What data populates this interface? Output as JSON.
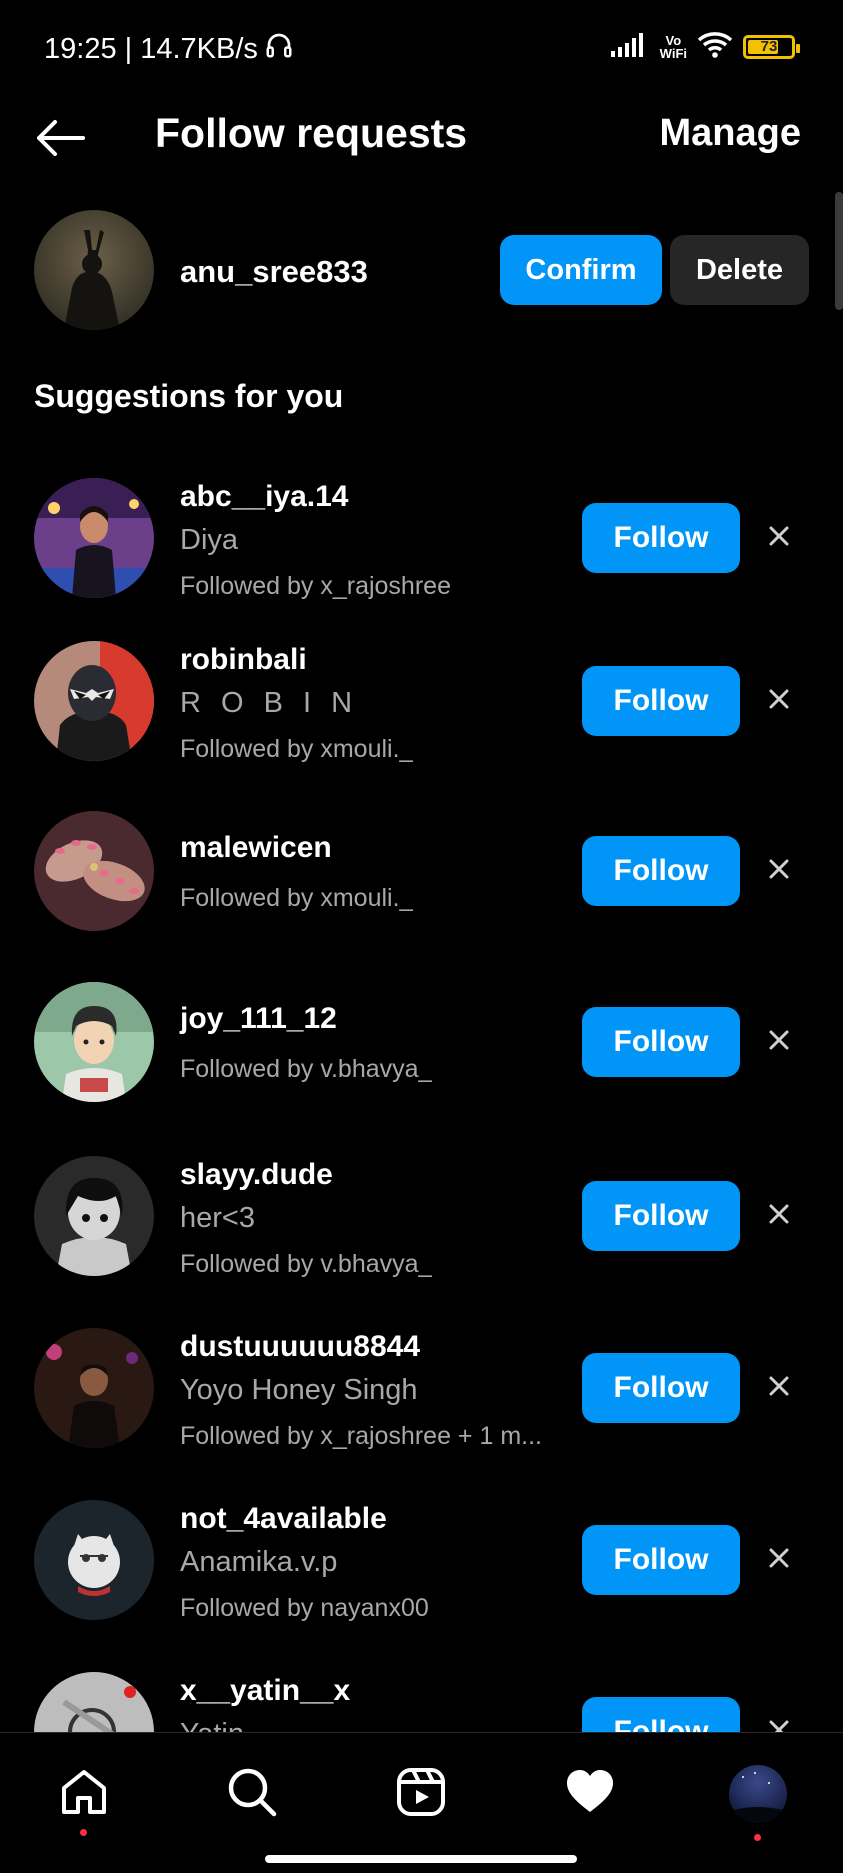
{
  "status_bar": {
    "time_speed": "19:25 | 14.7KB/s",
    "vowifi_top": "Vo",
    "vowifi_bottom": "WiFi",
    "battery": "73",
    "battery_level": 0.73,
    "battery_color": "#f2c200"
  },
  "header": {
    "title": "Follow requests",
    "manage_label": "Manage"
  },
  "request": {
    "username": "anu_sree833",
    "confirm_label": "Confirm",
    "delete_label": "Delete"
  },
  "suggestions_title": "Suggestions for you",
  "suggestions": [
    {
      "username": "abc__iya.14",
      "full_name": "Diya",
      "followed_by": "Followed by x_rajoshree",
      "follow_label": "Follow",
      "dismiss_icon": "close-icon"
    },
    {
      "username": "robinbali",
      "full_name": "R O B I N",
      "followed_by": "Followed by xmouli._",
      "follow_label": "Follow",
      "dismiss_icon": "close-icon"
    },
    {
      "username": "malewicen",
      "full_name": "",
      "followed_by": "Followed by xmouli._",
      "follow_label": "Follow",
      "dismiss_icon": "close-icon"
    },
    {
      "username": "joy_111_12",
      "full_name": "",
      "followed_by": "Followed by v.bhavya_",
      "follow_label": "Follow",
      "dismiss_icon": "close-icon"
    },
    {
      "username": "slayy.dude",
      "full_name": "her<3",
      "followed_by": "Followed by v.bhavya_",
      "follow_label": "Follow",
      "dismiss_icon": "close-icon"
    },
    {
      "username": "dustuuuuuu8844",
      "full_name": "Yoyo Honey Singh",
      "followed_by": "Followed by x_rajoshree + 1 m...",
      "follow_label": "Follow",
      "dismiss_icon": "close-icon"
    },
    {
      "username": "not_4available",
      "full_name": "Anamika.v.p",
      "followed_by": "Followed by nayanx00",
      "follow_label": "Follow",
      "dismiss_icon": "close-icon"
    },
    {
      "username": "x__yatin__x",
      "full_name": "Yatin",
      "followed_by": "",
      "follow_label": "Follow",
      "dismiss_icon": "close-icon"
    }
  ],
  "bottom_nav": [
    {
      "icon": "home-icon",
      "has_dot": true
    },
    {
      "icon": "search-icon",
      "has_dot": false
    },
    {
      "icon": "reels-icon",
      "has_dot": false
    },
    {
      "icon": "heart-icon",
      "has_dot": false
    },
    {
      "icon": "profile-avatar",
      "has_dot": true
    }
  ],
  "colors": {
    "accent": "#0095f6",
    "secondary_button": "#262626",
    "muted_text": "#a8a8a8",
    "notification_dot": "#ff3040"
  }
}
